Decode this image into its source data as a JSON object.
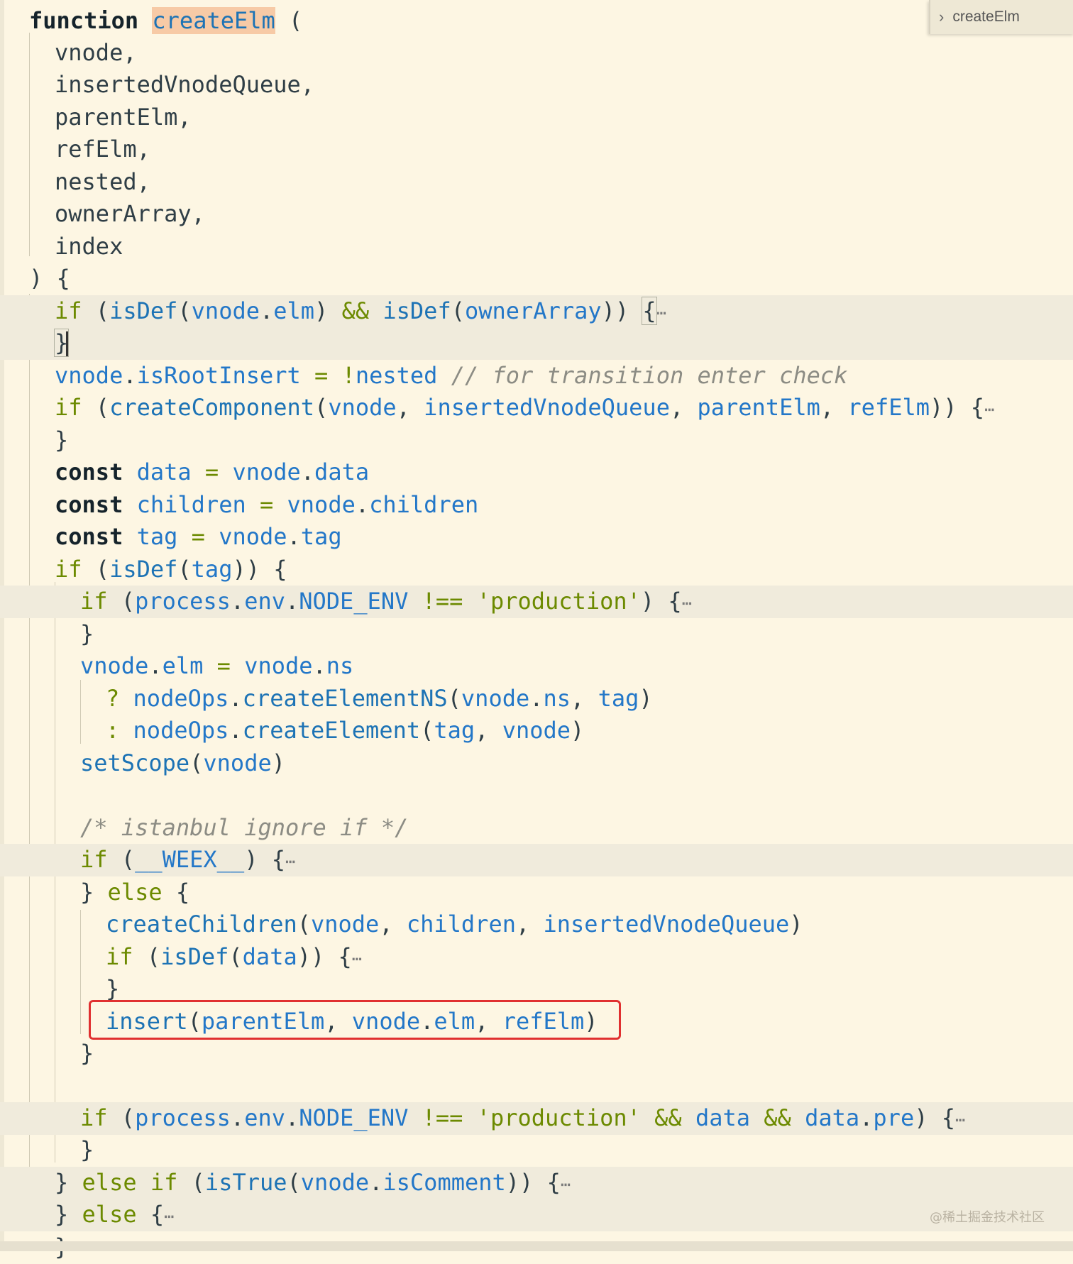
{
  "sticky_scroll": {
    "chevron": "›",
    "label": "createElm"
  },
  "watermark": "@稀土掘金技术社区",
  "code": {
    "l01": {
      "kw": "function",
      "name": "createElm",
      "open": " ("
    },
    "params": [
      "vnode,",
      "insertedVnodeQueue,",
      "parentElm,",
      "refElm,",
      "nested,",
      "ownerArray,",
      "index"
    ],
    "l09": ") {",
    "l10": {
      "if": "if",
      "p1": " (",
      "isDef1": "isDef",
      "p2": "(",
      "vnode": "vnode",
      "dot": ".",
      "elm": "elm",
      "p3": ") ",
      "and": "&&",
      "sp": " ",
      "isDef2": "isDef",
      "p4": "(",
      "ownerArray": "ownerArray",
      "p5": ")) ",
      "brace": "{",
      "dots": "⋯"
    },
    "l11": "}",
    "l12": {
      "vnode": "vnode",
      "dot": ".",
      "isRootInsert": "isRootInsert",
      "eq": " = ",
      "not": "!",
      "nested": "nested",
      "comment": " // for transition enter check"
    },
    "l13": {
      "if": "if",
      "p1": " (",
      "fn": "createComponent",
      "p2": "(",
      "a1": "vnode",
      "c1": ", ",
      "a2": "insertedVnodeQueue",
      "c2": ", ",
      "a3": "parentElm",
      "c3": ", ",
      "a4": "refElm",
      "p3": ")) {",
      "dots": "⋯"
    },
    "l14": "}",
    "l15": {
      "kw": "const",
      "name": "data",
      "eq": " = ",
      "obj": "vnode",
      "dot": ".",
      "prop": "data"
    },
    "l16": {
      "kw": "const",
      "name": "children",
      "eq": " = ",
      "obj": "vnode",
      "dot": ".",
      "prop": "children"
    },
    "l17": {
      "kw": "const",
      "name": "tag",
      "eq": " = ",
      "obj": "vnode",
      "dot": ".",
      "prop": "tag"
    },
    "l18": {
      "if": "if",
      "p1": " (",
      "fn": "isDef",
      "p2": "(",
      "a": "tag",
      "p3": ")) {"
    },
    "l19": {
      "if": "if",
      "p1": " (",
      "process": "process",
      "d1": ".",
      "env": "env",
      "d2": ".",
      "node_env": "NODE_ENV",
      "neq": " !== ",
      "str": "'production'",
      "p2": ") {",
      "dots": "⋯"
    },
    "l20": "}",
    "l21": {
      "vnode": "vnode",
      "dot": ".",
      "elm": "elm",
      "eq": " = ",
      "vnode2": "vnode",
      "dot2": ".",
      "ns": "ns"
    },
    "l22": {
      "q": "? ",
      "nodeOps": "nodeOps",
      "dot": ".",
      "fn": "createElementNS",
      "p1": "(",
      "a1": "vnode",
      "d": ".",
      "a1b": "ns",
      "c": ", ",
      "a2": "tag",
      "p2": ")"
    },
    "l23": {
      "colon": ": ",
      "nodeOps": "nodeOps",
      "dot": ".",
      "fn": "createElement",
      "p1": "(",
      "a1": "tag",
      "c": ", ",
      "a2": "vnode",
      "p2": ")"
    },
    "l24": {
      "fn": "setScope",
      "p1": "(",
      "a": "vnode",
      "p2": ")"
    },
    "l26": "/* istanbul ignore if */",
    "l27": {
      "if": "if",
      "p1": " (",
      "weex": "__WEEX__",
      "p2": ") {",
      "dots": "⋯"
    },
    "l28": {
      "close": "} ",
      "else": "else",
      "open": " {"
    },
    "l29": {
      "fn": "createChildren",
      "p1": "(",
      "a1": "vnode",
      "c1": ", ",
      "a2": "children",
      "c2": ", ",
      "a3": "insertedVnodeQueue",
      "p2": ")"
    },
    "l30": {
      "if": "if",
      "p1": " (",
      "fn": "isDef",
      "p2": "(",
      "a": "data",
      "p3": ")) {",
      "dots": "⋯"
    },
    "l31": "}",
    "l32": {
      "fn": "insert",
      "p1": "(",
      "a1": "parentElm",
      "c1": ", ",
      "a2": "vnode",
      "d": ".",
      "a2b": "elm",
      "c2": ", ",
      "a3": "refElm",
      "p2": ")"
    },
    "l33": "}",
    "l35": {
      "if": "if",
      "p1": " (",
      "process": "process",
      "d1": ".",
      "env": "env",
      "d2": ".",
      "node_env": "NODE_ENV",
      "neq": " !== ",
      "str": "'production'",
      "and1": " && ",
      "data": "data",
      "and2": " && ",
      "data2": "data",
      "d3": ".",
      "pre": "pre",
      "p2": ") {",
      "dots": "⋯"
    },
    "l36": "}",
    "l37": {
      "close": "} ",
      "else": "else",
      "sp": " ",
      "if": "if",
      "p1": " (",
      "fn": "isTrue",
      "p2": "(",
      "a": "vnode",
      "d": ".",
      "b": "isComment",
      "p3": ")) {",
      "dots": "⋯"
    },
    "l38": {
      "close": "} ",
      "else": "else",
      "open": " {",
      "dots": "⋯"
    },
    "l39": "}"
  }
}
